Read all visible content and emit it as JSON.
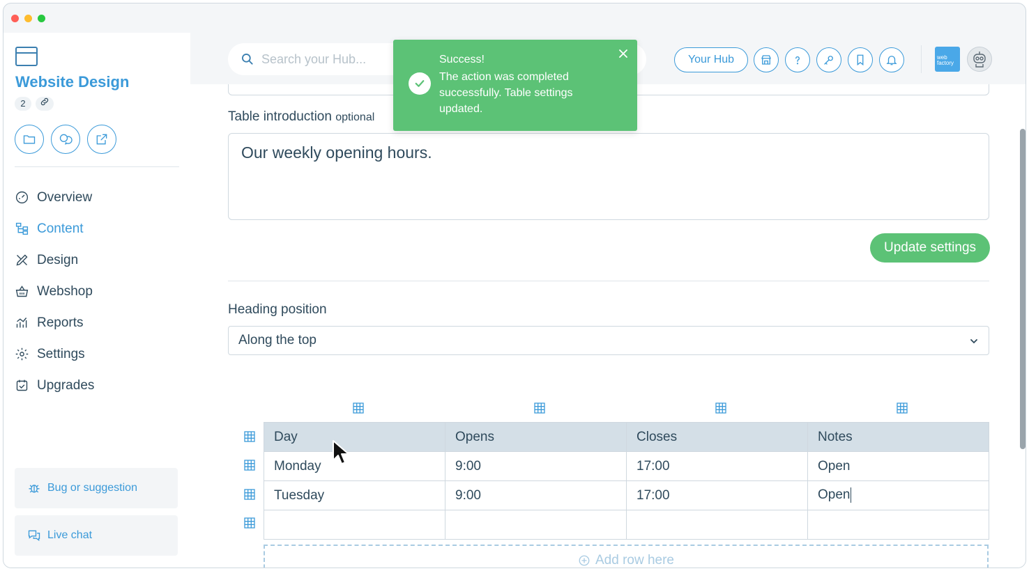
{
  "sidebar": {
    "site_title": "Website Design",
    "badge_count": "2",
    "nav": [
      {
        "label": "Overview",
        "icon": "dashboard-icon"
      },
      {
        "label": "Content",
        "icon": "content-tree-icon",
        "active": true
      },
      {
        "label": "Design",
        "icon": "design-tools-icon"
      },
      {
        "label": "Webshop",
        "icon": "basket-icon"
      },
      {
        "label": "Reports",
        "icon": "chart-icon"
      },
      {
        "label": "Settings",
        "icon": "gear-icon"
      },
      {
        "label": "Upgrades",
        "icon": "calendar-check-icon"
      }
    ],
    "bug_label": "Bug or suggestion",
    "chat_label": "Live chat"
  },
  "topbar": {
    "search_placeholder": "Search your Hub...",
    "hub_label": "Your Hub",
    "logo_text": "web factory"
  },
  "toast": {
    "title": "Success!",
    "message": "The action was completed successfully. Table settings updated."
  },
  "form": {
    "intro_label": "Table introduction",
    "intro_optional": "optional",
    "intro_value": "Our weekly opening hours.",
    "update_label": "Update settings",
    "heading_label": "Heading position",
    "heading_value": "Along the top"
  },
  "table": {
    "headers": [
      "Day",
      "Opens",
      "Closes",
      "Notes"
    ],
    "rows": [
      [
        "Monday",
        "9:00",
        "17:00",
        "Open"
      ],
      [
        "Tuesday",
        "9:00",
        "17:00",
        "Open"
      ],
      [
        "",
        "",
        "",
        ""
      ]
    ],
    "add_row_label": "Add row here"
  },
  "colors": {
    "accent": "#3b9ad9",
    "success": "#5cc276",
    "text": "#2f4a5c",
    "table_header": "#d4dfe7"
  }
}
